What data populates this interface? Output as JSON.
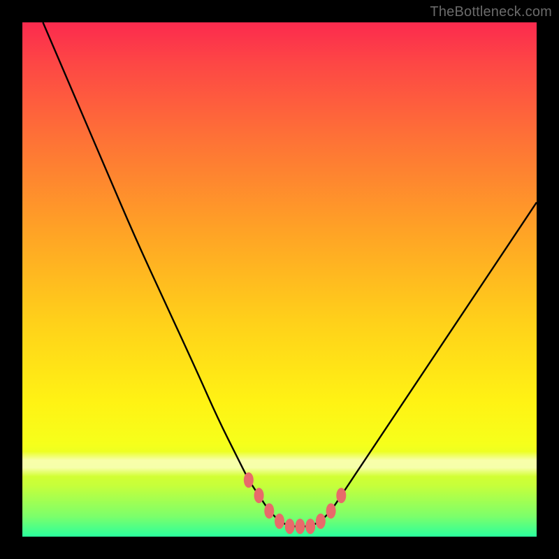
{
  "watermark": "TheBottleneck.com",
  "chart_data": {
    "type": "line",
    "title": "",
    "xlabel": "",
    "ylabel": "",
    "xlim": [
      0,
      100
    ],
    "ylim": [
      0,
      100
    ],
    "grid": false,
    "series": [
      {
        "name": "curve",
        "color": "#000000",
        "x": [
          4,
          10,
          16,
          22,
          28,
          34,
          38,
          42,
          44,
          46,
          48,
          50,
          52,
          54,
          56,
          58,
          60,
          62,
          66,
          72,
          80,
          90,
          100
        ],
        "values": [
          100,
          86,
          72,
          58,
          45,
          32,
          23,
          15,
          11,
          8,
          5,
          3,
          2,
          2,
          2,
          3,
          5,
          8,
          14,
          23,
          35,
          50,
          65
        ]
      },
      {
        "name": "markers",
        "type": "scatter",
        "color": "#e86a6a",
        "x": [
          44,
          46,
          48,
          50,
          52,
          54,
          56,
          58,
          60,
          62
        ],
        "values": [
          11,
          8,
          5,
          3,
          2,
          2,
          2,
          3,
          5,
          8
        ]
      },
      {
        "name": "highlight-band",
        "type": "area",
        "color": "#ffffd5",
        "y_range": [
          15,
          19
        ]
      }
    ]
  }
}
